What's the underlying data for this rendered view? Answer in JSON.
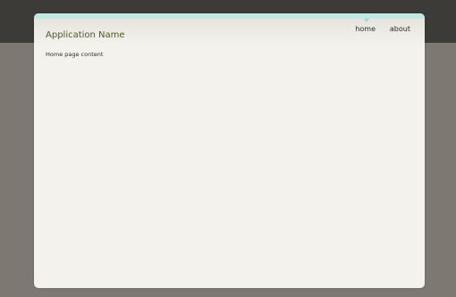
{
  "app": {
    "title": "Application Name"
  },
  "nav": {
    "items": [
      {
        "label": "home",
        "active": true
      },
      {
        "label": "about",
        "active": false
      }
    ]
  },
  "main": {
    "body_text": "Home page content"
  },
  "colors": {
    "accent": "#bfe9e2",
    "title": "#4b5a25",
    "page_background": "#f4f2ed",
    "outer_background": "#7d7872",
    "top_band": "#3d3b38"
  }
}
